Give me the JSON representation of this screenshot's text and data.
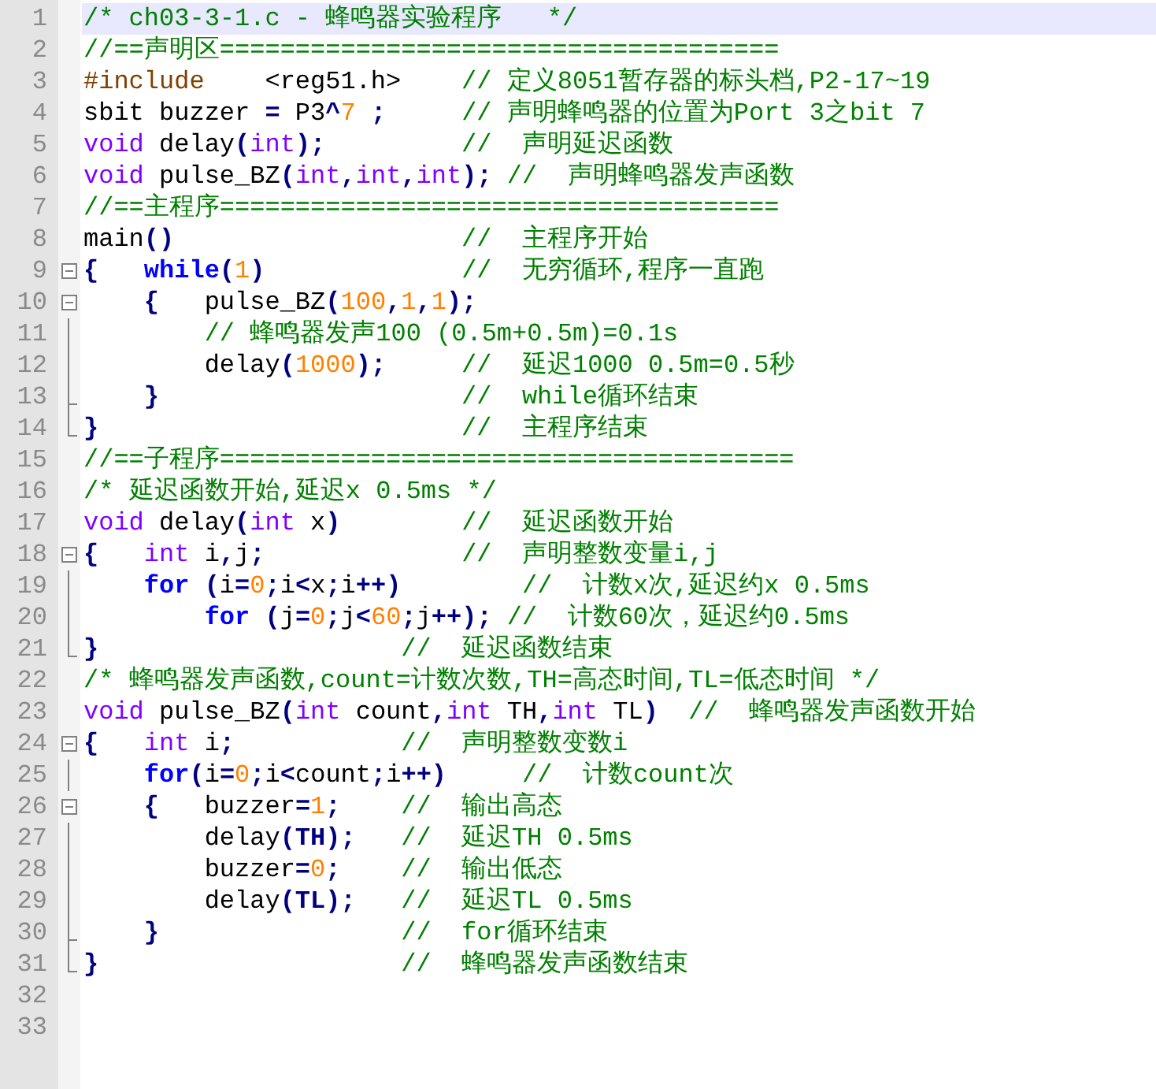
{
  "lines": [
    {
      "number": "1",
      "kind": "plain",
      "current": true,
      "tokens": [
        {
          "kind": "comment",
          "text": "/* ch03-3-1.c - 蜂鸣器实验程序   */"
        }
      ]
    },
    {
      "number": "2",
      "kind": "plain",
      "current": false,
      "tokens": [
        {
          "kind": "comment",
          "text": "//==声明区====================================="
        }
      ]
    },
    {
      "number": "3",
      "kind": "plain",
      "current": false,
      "tokens": [
        {
          "kind": "preprocessor",
          "text": "#include"
        },
        {
          "kind": "plain",
          "text": "    <reg51.h>"
        },
        {
          "kind": "comment",
          "text": "    // 定义8051暂存器的标头档,P2-17~19"
        }
      ]
    },
    {
      "number": "4",
      "kind": "plain",
      "current": false,
      "tokens": [
        {
          "kind": "plain",
          "text": "sbit buzzer "
        },
        {
          "kind": "operator",
          "text": "="
        },
        {
          "kind": "plain",
          "text": " P3"
        },
        {
          "kind": "operator",
          "text": "^"
        },
        {
          "kind": "number",
          "text": "7"
        },
        {
          "kind": "operator",
          "text": " ;"
        },
        {
          "kind": "comment",
          "text": "     // 声明蜂鸣器的位置为Port 3之bit 7"
        }
      ]
    },
    {
      "number": "5",
      "kind": "plain",
      "current": false,
      "tokens": [
        {
          "kind": "type",
          "text": "void"
        },
        {
          "kind": "plain",
          "text": " delay"
        },
        {
          "kind": "operator",
          "text": "("
        },
        {
          "kind": "type",
          "text": "int"
        },
        {
          "kind": "operator",
          "text": ");"
        },
        {
          "kind": "comment",
          "text": "         //  声明延迟函数"
        }
      ]
    },
    {
      "number": "6",
      "kind": "plain",
      "current": false,
      "tokens": [
        {
          "kind": "type",
          "text": "void"
        },
        {
          "kind": "plain",
          "text": " pulse_BZ"
        },
        {
          "kind": "operator",
          "text": "("
        },
        {
          "kind": "type",
          "text": "int"
        },
        {
          "kind": "operator",
          "text": ","
        },
        {
          "kind": "type",
          "text": "int"
        },
        {
          "kind": "operator",
          "text": ","
        },
        {
          "kind": "type",
          "text": "int"
        },
        {
          "kind": "operator",
          "text": ");"
        },
        {
          "kind": "comment",
          "text": " //  声明蜂鸣器发声函数"
        }
      ]
    },
    {
      "number": "7",
      "kind": "plain",
      "current": false,
      "tokens": [
        {
          "kind": "comment",
          "text": "//==主程序====================================="
        }
      ]
    },
    {
      "number": "8",
      "kind": "plain",
      "current": false,
      "tokens": [
        {
          "kind": "plain",
          "text": "main"
        },
        {
          "kind": "operator",
          "text": "()"
        },
        {
          "kind": "comment",
          "text": "                   //  主程序开始"
        }
      ]
    },
    {
      "number": "9",
      "kind": "start",
      "current": false,
      "tokens": [
        {
          "kind": "operator",
          "text": "{"
        },
        {
          "kind": "keyword",
          "text": "   while"
        },
        {
          "kind": "operator",
          "text": "("
        },
        {
          "kind": "number",
          "text": "1"
        },
        {
          "kind": "operator",
          "text": ")"
        },
        {
          "kind": "comment",
          "text": "             //  无穷循环,程序一直跑"
        }
      ]
    },
    {
      "number": "10",
      "kind": "start",
      "current": false,
      "tokens": [
        {
          "kind": "operator",
          "text": "    {"
        },
        {
          "kind": "plain",
          "text": "   pulse_BZ"
        },
        {
          "kind": "operator",
          "text": "("
        },
        {
          "kind": "number",
          "text": "100"
        },
        {
          "kind": "operator",
          "text": ","
        },
        {
          "kind": "number",
          "text": "1"
        },
        {
          "kind": "operator",
          "text": ","
        },
        {
          "kind": "number",
          "text": "1"
        },
        {
          "kind": "operator",
          "text": ");"
        }
      ]
    },
    {
      "number": "11",
      "kind": "inside",
      "current": false,
      "tokens": [
        {
          "kind": "comment",
          "text": "        // 蜂鸣器发声100 (0.5m+0.5m)=0.1s"
        }
      ]
    },
    {
      "number": "12",
      "kind": "inside",
      "current": false,
      "tokens": [
        {
          "kind": "plain",
          "text": "        delay"
        },
        {
          "kind": "operator",
          "text": "("
        },
        {
          "kind": "number",
          "text": "1000"
        },
        {
          "kind": "operator",
          "text": ");"
        },
        {
          "kind": "comment",
          "text": "     //  延迟1000 0.5m=0.5秒"
        }
      ]
    },
    {
      "number": "13",
      "kind": "subclose",
      "current": false,
      "tokens": [
        {
          "kind": "operator",
          "text": "    }"
        },
        {
          "kind": "comment",
          "text": "                    //  while循环结束"
        }
      ]
    },
    {
      "number": "14",
      "kind": "close",
      "current": false,
      "tokens": [
        {
          "kind": "operator",
          "text": "}"
        },
        {
          "kind": "comment",
          "text": "                        //  主程序结束"
        }
      ]
    },
    {
      "number": "15",
      "kind": "plain",
      "current": false,
      "tokens": [
        {
          "kind": "comment",
          "text": "//==子程序======================================"
        }
      ]
    },
    {
      "number": "16",
      "kind": "plain",
      "current": false,
      "tokens": [
        {
          "kind": "comment",
          "text": "/* 延迟函数开始,延迟x 0.5ms */"
        }
      ]
    },
    {
      "number": "17",
      "kind": "plain",
      "current": false,
      "tokens": [
        {
          "kind": "type",
          "text": "void"
        },
        {
          "kind": "plain",
          "text": " delay"
        },
        {
          "kind": "operator",
          "text": "("
        },
        {
          "kind": "type",
          "text": "int"
        },
        {
          "kind": "plain",
          "text": " x"
        },
        {
          "kind": "operator",
          "text": ")"
        },
        {
          "kind": "comment",
          "text": "        //  延迟函数开始"
        }
      ]
    },
    {
      "number": "18",
      "kind": "start",
      "current": false,
      "tokens": [
        {
          "kind": "operator",
          "text": "{"
        },
        {
          "kind": "type",
          "text": "   int"
        },
        {
          "kind": "plain",
          "text": " i"
        },
        {
          "kind": "operator",
          "text": ","
        },
        {
          "kind": "plain",
          "text": "j"
        },
        {
          "kind": "operator",
          "text": ";"
        },
        {
          "kind": "comment",
          "text": "             //  声明整数变量i,j"
        }
      ]
    },
    {
      "number": "19",
      "kind": "inside",
      "current": false,
      "tokens": [
        {
          "kind": "keyword",
          "text": "    for"
        },
        {
          "kind": "operator",
          "text": " ("
        },
        {
          "kind": "plain",
          "text": "i"
        },
        {
          "kind": "operator",
          "text": "="
        },
        {
          "kind": "number",
          "text": "0"
        },
        {
          "kind": "operator",
          "text": ";"
        },
        {
          "kind": "plain",
          "text": "i"
        },
        {
          "kind": "operator",
          "text": "<"
        },
        {
          "kind": "plain",
          "text": "x"
        },
        {
          "kind": "operator",
          "text": ";"
        },
        {
          "kind": "plain",
          "text": "i"
        },
        {
          "kind": "operator",
          "text": "++)"
        },
        {
          "kind": "comment",
          "text": "        //  计数x次,延迟约x 0.5ms"
        }
      ]
    },
    {
      "number": "20",
      "kind": "inside",
      "current": false,
      "tokens": [
        {
          "kind": "keyword",
          "text": "        for"
        },
        {
          "kind": "operator",
          "text": " ("
        },
        {
          "kind": "plain",
          "text": "j"
        },
        {
          "kind": "operator",
          "text": "="
        },
        {
          "kind": "number",
          "text": "0"
        },
        {
          "kind": "operator",
          "text": ";"
        },
        {
          "kind": "plain",
          "text": "j"
        },
        {
          "kind": "operator",
          "text": "<"
        },
        {
          "kind": "number",
          "text": "60"
        },
        {
          "kind": "operator",
          "text": ";"
        },
        {
          "kind": "plain",
          "text": "j"
        },
        {
          "kind": "operator",
          "text": "++);"
        },
        {
          "kind": "comment",
          "text": " //  计数60次，延迟约0.5ms"
        }
      ]
    },
    {
      "number": "21",
      "kind": "close",
      "current": false,
      "tokens": [
        {
          "kind": "operator",
          "text": "}"
        },
        {
          "kind": "comment",
          "text": "                    //  延迟函数结束"
        }
      ]
    },
    {
      "number": "22",
      "kind": "plain",
      "current": false,
      "tokens": [
        {
          "kind": "comment",
          "text": "/* 蜂鸣器发声函数,count=计数次数,TH=高态时间,TL=低态时间 */"
        }
      ]
    },
    {
      "number": "23",
      "kind": "plain",
      "current": false,
      "tokens": [
        {
          "kind": "type",
          "text": "void"
        },
        {
          "kind": "plain",
          "text": " pulse_BZ"
        },
        {
          "kind": "operator",
          "text": "("
        },
        {
          "kind": "type",
          "text": "int"
        },
        {
          "kind": "plain",
          "text": " count"
        },
        {
          "kind": "operator",
          "text": ","
        },
        {
          "kind": "type",
          "text": "int"
        },
        {
          "kind": "plain",
          "text": " TH"
        },
        {
          "kind": "operator",
          "text": ","
        },
        {
          "kind": "type",
          "text": "int"
        },
        {
          "kind": "plain",
          "text": " TL"
        },
        {
          "kind": "operator",
          "text": ")"
        },
        {
          "kind": "comment",
          "text": "  //  蜂鸣器发声函数开始"
        }
      ]
    },
    {
      "number": "24",
      "kind": "start",
      "current": false,
      "tokens": [
        {
          "kind": "operator",
          "text": "{"
        },
        {
          "kind": "type",
          "text": "   int"
        },
        {
          "kind": "plain",
          "text": " i"
        },
        {
          "kind": "operator",
          "text": ";"
        },
        {
          "kind": "comment",
          "text": "           //  声明整数变数i"
        }
      ]
    },
    {
      "number": "25",
      "kind": "inside",
      "current": false,
      "tokens": [
        {
          "kind": "keyword",
          "text": "    for"
        },
        {
          "kind": "operator",
          "text": "("
        },
        {
          "kind": "plain",
          "text": "i"
        },
        {
          "kind": "operator",
          "text": "="
        },
        {
          "kind": "number",
          "text": "0"
        },
        {
          "kind": "operator",
          "text": ";"
        },
        {
          "kind": "plain",
          "text": "i"
        },
        {
          "kind": "operator",
          "text": "<"
        },
        {
          "kind": "plain",
          "text": "count"
        },
        {
          "kind": "operator",
          "text": ";"
        },
        {
          "kind": "plain",
          "text": "i"
        },
        {
          "kind": "operator",
          "text": "++)"
        },
        {
          "kind": "comment",
          "text": "     //  计数count次"
        }
      ]
    },
    {
      "number": "26",
      "kind": "start",
      "current": false,
      "tokens": [
        {
          "kind": "operator",
          "text": "    {"
        },
        {
          "kind": "plain",
          "text": "   buzzer"
        },
        {
          "kind": "operator",
          "text": "="
        },
        {
          "kind": "number",
          "text": "1"
        },
        {
          "kind": "operator",
          "text": ";"
        },
        {
          "kind": "comment",
          "text": "    //  输出高态"
        }
      ]
    },
    {
      "number": "27",
      "kind": "inside",
      "current": false,
      "tokens": [
        {
          "kind": "plain",
          "text": "        delay"
        },
        {
          "kind": "operator",
          "text": "(TH);"
        },
        {
          "kind": "comment",
          "text": "   //  延迟TH 0.5ms"
        }
      ]
    },
    {
      "number": "28",
      "kind": "inside",
      "current": false,
      "tokens": [
        {
          "kind": "plain",
          "text": "        buzzer"
        },
        {
          "kind": "operator",
          "text": "="
        },
        {
          "kind": "number",
          "text": "0"
        },
        {
          "kind": "operator",
          "text": ";"
        },
        {
          "kind": "comment",
          "text": "    //  输出低态"
        }
      ]
    },
    {
      "number": "29",
      "kind": "inside",
      "current": false,
      "tokens": [
        {
          "kind": "plain",
          "text": "        delay"
        },
        {
          "kind": "operator",
          "text": "(TL);"
        },
        {
          "kind": "comment",
          "text": "   //  延迟TL 0.5ms"
        }
      ]
    },
    {
      "number": "30",
      "kind": "subclose",
      "current": false,
      "tokens": [
        {
          "kind": "operator",
          "text": "    }"
        },
        {
          "kind": "comment",
          "text": "                //  for循环结束"
        }
      ]
    },
    {
      "number": "31",
      "kind": "close",
      "current": false,
      "tokens": [
        {
          "kind": "operator",
          "text": "}"
        },
        {
          "kind": "comment",
          "text": "                    //  蜂鸣器发声函数结束"
        }
      ]
    },
    {
      "number": "32",
      "kind": "plain",
      "current": false
    },
    {
      "number": "33",
      "kind": "plain",
      "current": false
    }
  ]
}
